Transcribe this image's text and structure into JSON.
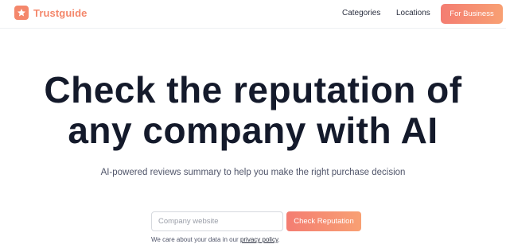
{
  "header": {
    "brand_name": "Trustguide",
    "brand_icon": "star-icon",
    "nav": {
      "categories": "Categories",
      "locations": "Locations"
    },
    "cta_label": "For Business"
  },
  "hero": {
    "headline_line1": "Check the reputation of",
    "headline_line2": "any company with AI",
    "subheadline": "AI-powered reviews summary to help you make the right purchase decision"
  },
  "search": {
    "placeholder": "Company website",
    "value": "",
    "button_label": "Check Reputation"
  },
  "privacy": {
    "text": "We care about your data in our",
    "link_label": "privacy policy",
    "suffix": "."
  },
  "colors": {
    "brand": "#f4876b",
    "cta_gradient_start": "#f47d72",
    "cta_gradient_end": "#f8a073",
    "headline": "#141a2b"
  }
}
